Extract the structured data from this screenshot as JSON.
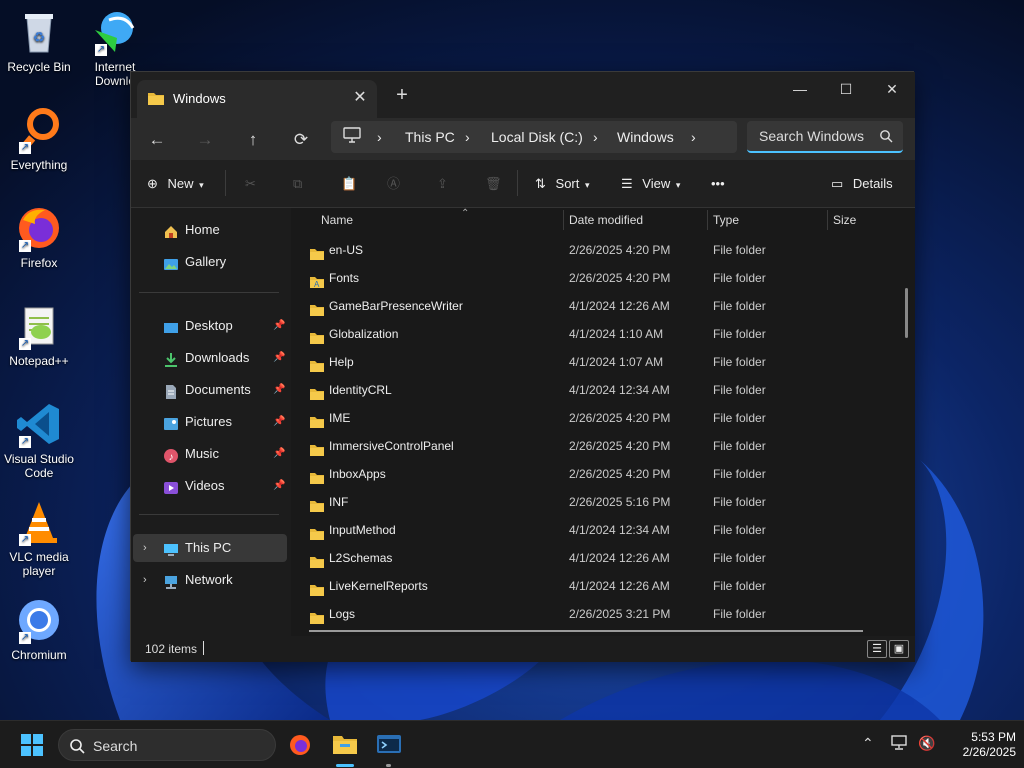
{
  "desktop": {
    "icons": [
      {
        "label": "Recycle Bin"
      },
      {
        "label": "Internet Downlo"
      },
      {
        "label": "Everything"
      },
      {
        "label": "Firefox"
      },
      {
        "label": "Notepad++"
      },
      {
        "label": "Visual Studio Code"
      },
      {
        "label": "VLC media player"
      },
      {
        "label": "Chromium"
      }
    ]
  },
  "explorer": {
    "tab_title": "Windows",
    "tab_close": "✕",
    "new_tab": "+",
    "window_controls": {
      "minimize": "—",
      "maximize": "☐",
      "close": "✕"
    },
    "nav": {
      "back": "←",
      "forward": "→",
      "up": "↑",
      "refresh": "⟳"
    },
    "breadcrumb": [
      "This PC",
      "Local Disk (C:)",
      "Windows"
    ],
    "search_value": "Search Windows",
    "toolbar": {
      "new_label": "New",
      "sort_label": "Sort",
      "view_label": "View",
      "more_label": "•••",
      "details_label": "Details"
    },
    "sidebar": {
      "top": [
        {
          "label": "Home"
        },
        {
          "label": "Gallery"
        }
      ],
      "pinned": [
        {
          "label": "Desktop"
        },
        {
          "label": "Downloads"
        },
        {
          "label": "Documents"
        },
        {
          "label": "Pictures"
        },
        {
          "label": "Music"
        },
        {
          "label": "Videos"
        }
      ],
      "bottom": [
        {
          "label": "This PC"
        },
        {
          "label": "Network"
        }
      ]
    },
    "columns": {
      "name": "Name",
      "date": "Date modified",
      "type": "Type",
      "size": "Size"
    },
    "rows": [
      {
        "name": "en-US",
        "date": "2/26/2025 4:20 PM",
        "type": "File folder"
      },
      {
        "name": "Fonts",
        "date": "2/26/2025 4:20 PM",
        "type": "File folder"
      },
      {
        "name": "GameBarPresenceWriter",
        "date": "4/1/2024 12:26 AM",
        "type": "File folder"
      },
      {
        "name": "Globalization",
        "date": "4/1/2024 1:10 AM",
        "type": "File folder"
      },
      {
        "name": "Help",
        "date": "4/1/2024 1:07 AM",
        "type": "File folder"
      },
      {
        "name": "IdentityCRL",
        "date": "4/1/2024 12:34 AM",
        "type": "File folder"
      },
      {
        "name": "IME",
        "date": "2/26/2025 4:20 PM",
        "type": "File folder"
      },
      {
        "name": "ImmersiveControlPanel",
        "date": "2/26/2025 4:20 PM",
        "type": "File folder"
      },
      {
        "name": "InboxApps",
        "date": "2/26/2025 4:20 PM",
        "type": "File folder"
      },
      {
        "name": "INF",
        "date": "2/26/2025 5:16 PM",
        "type": "File folder"
      },
      {
        "name": "InputMethod",
        "date": "4/1/2024 12:34 AM",
        "type": "File folder"
      },
      {
        "name": "L2Schemas",
        "date": "4/1/2024 12:26 AM",
        "type": "File folder"
      },
      {
        "name": "LiveKernelReports",
        "date": "4/1/2024 12:26 AM",
        "type": "File folder"
      },
      {
        "name": "Logs",
        "date": "2/26/2025 3:21 PM",
        "type": "File folder"
      }
    ],
    "status": {
      "item_count": "102 items"
    }
  },
  "taskbar": {
    "search_label": "Search",
    "time": "5:53 PM",
    "date": "2/26/2025"
  },
  "colors": {
    "accent": "#4cc2ff",
    "folder": "#e8b939",
    "window_bg": "#1c1c1c"
  }
}
